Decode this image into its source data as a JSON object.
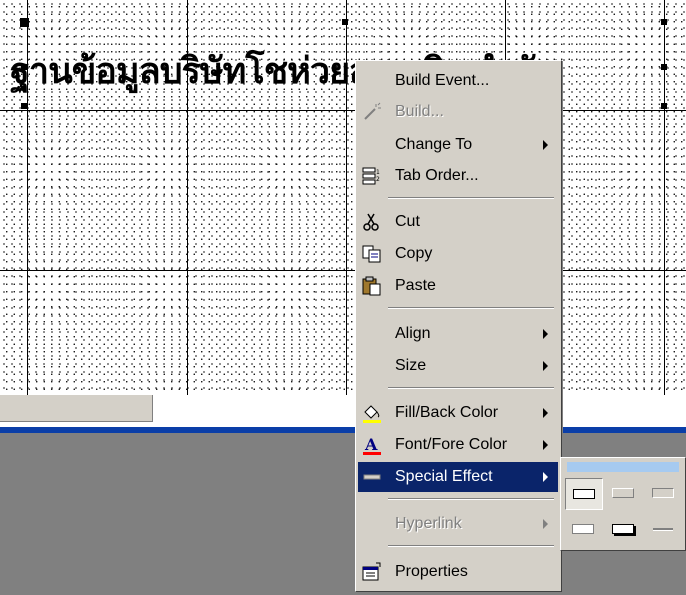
{
  "form": {
    "title": "ฐานข้อมูลบริษัทโชห่วยสุขเจริญจำกัด"
  },
  "context_menu": {
    "items": [
      {
        "label": "Build Event...",
        "icon": "none",
        "disabled": false,
        "submenu": false
      },
      {
        "label": "Build...",
        "icon": "wand-icon",
        "disabled": true,
        "submenu": false
      },
      {
        "label": "Change To",
        "icon": "none",
        "disabled": false,
        "submenu": true
      },
      {
        "label": "Tab Order...",
        "icon": "tab-order-icon",
        "disabled": false,
        "submenu": false
      },
      {
        "label": "Cut",
        "icon": "scissors-icon",
        "disabled": false,
        "submenu": false
      },
      {
        "label": "Copy",
        "icon": "copy-icon",
        "disabled": false,
        "submenu": false
      },
      {
        "label": "Paste",
        "icon": "paste-icon",
        "disabled": false,
        "submenu": false
      },
      {
        "label": "Align",
        "icon": "none",
        "disabled": false,
        "submenu": true
      },
      {
        "label": "Size",
        "icon": "none",
        "disabled": false,
        "submenu": true
      },
      {
        "label": "Fill/Back Color",
        "icon": "fill-bucket-icon",
        "disabled": false,
        "submenu": true
      },
      {
        "label": "Font/Fore Color",
        "icon": "font-color-icon",
        "disabled": false,
        "submenu": true
      },
      {
        "label": "Special Effect",
        "icon": "special-effect-icon",
        "disabled": false,
        "submenu": true,
        "selected": true
      },
      {
        "label": "Hyperlink",
        "icon": "none",
        "disabled": true,
        "submenu": true
      },
      {
        "label": "Properties",
        "icon": "properties-icon",
        "disabled": false,
        "submenu": false
      }
    ]
  },
  "colors": {
    "selection": "#0a246a",
    "menu_bg": "#d4d0c8",
    "accent_bar": "#0a3ea8"
  }
}
